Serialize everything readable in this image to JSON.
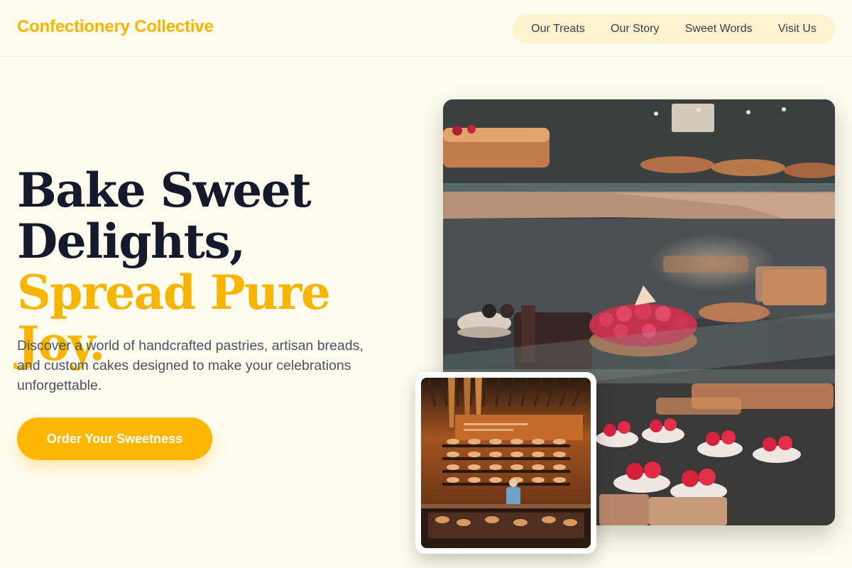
{
  "header": {
    "brand": "Confectionery Collective",
    "nav": [
      "Our Treats",
      "Our Story",
      "Sweet Words",
      "Visit Us"
    ]
  },
  "hero": {
    "title_line1": "Bake Sweet",
    "title_line2": "Delights,",
    "title_accent": "Spread Pure Joy.",
    "description": "Discover a world of handcrafted pastries, artisan breads, and custom cakes designed to make your celebrations unforgettable.",
    "cta_label": "Order Your Sweetness"
  },
  "images": {
    "main": "bakery-display-case-photo",
    "inset": "bakery-storefront-photo"
  },
  "colors": {
    "accent": "#f7b500",
    "button": "#ffb703",
    "background": "#fffcef",
    "heading": "#141a2b",
    "nav_pill": "#fdf3cf"
  }
}
